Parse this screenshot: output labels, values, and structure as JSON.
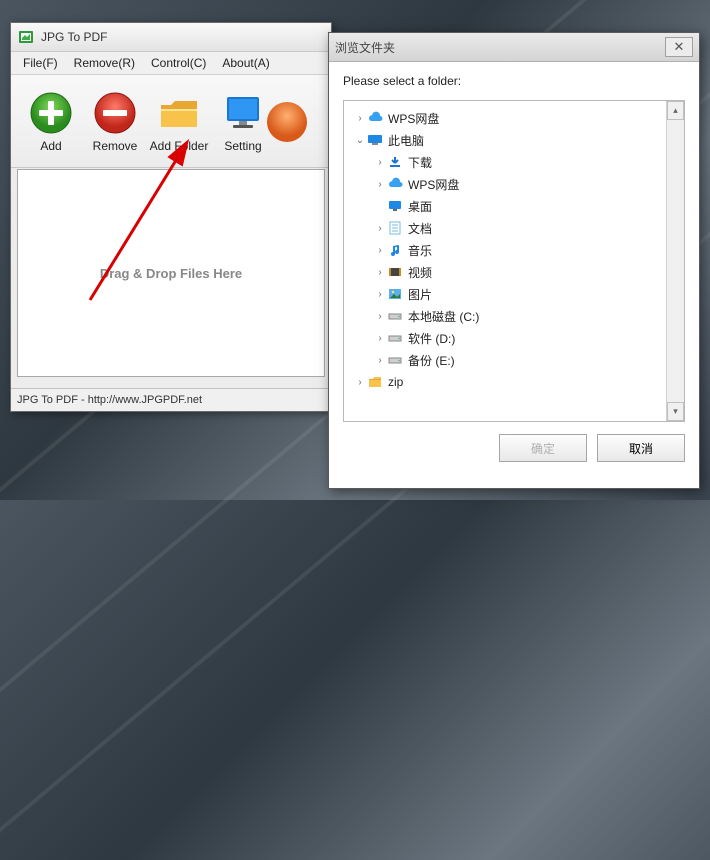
{
  "app": {
    "title": "JPG To PDF",
    "menu": {
      "file": "File(F)",
      "remove": "Remove(R)",
      "control": "Control(C)",
      "about": "About(A)"
    },
    "toolbar": {
      "add": "Add",
      "remove": "Remove",
      "add_folder": "Add Folder",
      "setting": "Setting"
    },
    "drop_text": "Drag & Drop Files Here",
    "status": "JPG To PDF - http://www.JPGPDF.net"
  },
  "dialog": {
    "title": "浏览文件夹",
    "prompt": "Please select a folder:",
    "tree": [
      {
        "indent": 0,
        "expander": "right",
        "icon": "cloud",
        "label": "WPS网盘"
      },
      {
        "indent": 0,
        "expander": "down",
        "icon": "pc",
        "label": "此电脑"
      },
      {
        "indent": 1,
        "expander": "right",
        "icon": "download",
        "label": "下载"
      },
      {
        "indent": 1,
        "expander": "right",
        "icon": "cloud",
        "label": "WPS网盘"
      },
      {
        "indent": 1,
        "expander": "none",
        "icon": "desktop",
        "label": "桌面"
      },
      {
        "indent": 1,
        "expander": "right",
        "icon": "doc",
        "label": "文档"
      },
      {
        "indent": 1,
        "expander": "right",
        "icon": "music",
        "label": "音乐"
      },
      {
        "indent": 1,
        "expander": "right",
        "icon": "video",
        "label": "视频"
      },
      {
        "indent": 1,
        "expander": "right",
        "icon": "pic",
        "label": "图片"
      },
      {
        "indent": 1,
        "expander": "right",
        "icon": "drive",
        "label": "本地磁盘 (C:)"
      },
      {
        "indent": 1,
        "expander": "right",
        "icon": "drive",
        "label": "软件 (D:)"
      },
      {
        "indent": 1,
        "expander": "right",
        "icon": "drive",
        "label": "备份 (E:)"
      },
      {
        "indent": 0,
        "expander": "right",
        "icon": "folder",
        "label": "zip"
      }
    ],
    "buttons": {
      "ok": "确定",
      "cancel": "取消"
    }
  }
}
